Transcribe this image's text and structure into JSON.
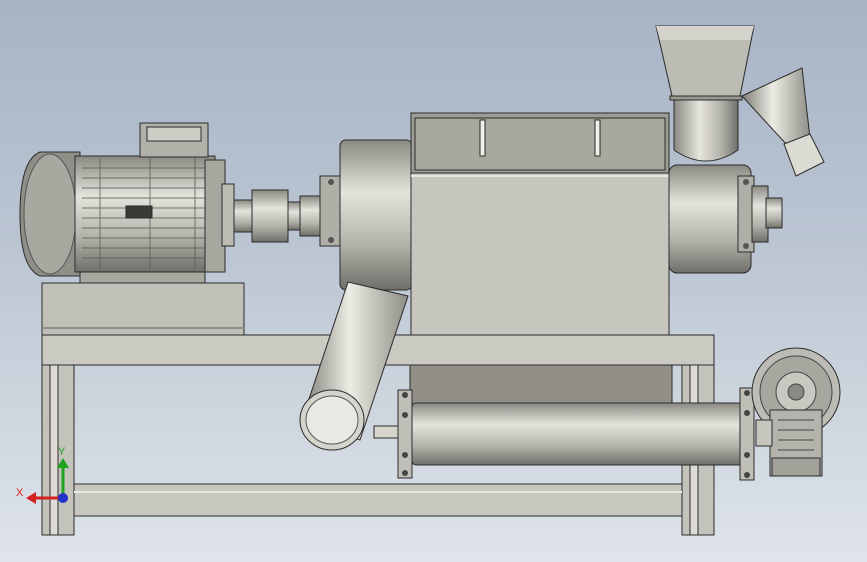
{
  "viewport": {
    "background_top": "#a7b4c6",
    "background_bottom": "#dfe4ea"
  },
  "triad": {
    "x_label": "X",
    "y_label": "Y",
    "x_color": "#d42020",
    "y_color": "#1fa31f",
    "z_color": "#2030c8"
  },
  "colors": {
    "metal_light": "#d6d5cd",
    "metal_mid": "#b9b8b0",
    "metal_dark": "#7c7b74",
    "frame": "#c9c8c0",
    "outline": "#2b2b2b"
  }
}
